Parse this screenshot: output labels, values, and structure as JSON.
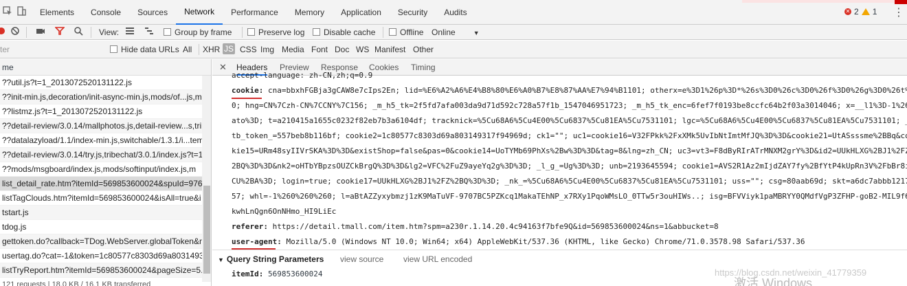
{
  "topbar": {
    "tabs": [
      "Elements",
      "Console",
      "Sources",
      "Network",
      "Performance",
      "Memory",
      "Application",
      "Security",
      "Audits"
    ],
    "active_tab": "Network",
    "error_count": "2",
    "warning_count": "1",
    "error_color": "#d93025",
    "warning_color": "#f2a600",
    "accent": "#1a73e8"
  },
  "toolbar": {
    "view_label": "View:",
    "group_by_frame": "Group by frame",
    "preserve_log": "Preserve log",
    "disable_cache": "Disable cache",
    "offline": "Offline",
    "throttle": "Online"
  },
  "filterbar": {
    "filter_placeholder": "ter",
    "hide_data_urls": "Hide data URLs",
    "types": [
      "All",
      "XHR",
      "JS",
      "CSS",
      "Img",
      "Media",
      "Font",
      "Doc",
      "WS",
      "Manifest",
      "Other"
    ],
    "selected_type": "JS"
  },
  "requests": {
    "name_header": "me",
    "rows": [
      "??util.js?t=1_2013072520131122.js",
      "??init-min.js,decoration/init-async-min.js,mods/of...js,m",
      "??listmz.js?t=1_2013072520131122.js",
      "??detail-review/3.0.14/mallphotos.js,detail-review...s,trib",
      "??datalazyload/1.1/index-min.js,switchable/1.3.1/i...tem",
      "??detail-review/3.0.14/try.js,tribechat/3.0.1/index.js?t=1",
      "??mods/msgboard/index.js,mods/softinput/index.js,m",
      "list_detail_rate.htm?itemId=569853600024&spuId=976",
      "listTagClouds.htm?itemId=569853600024&isAll=true&i",
      "tstart.js",
      "tdog.js",
      "gettoken.do?callback=TDog.WebServer.globalToken&n",
      "usertag.do?cat=-1&token=1c80577c8303d69a8031493",
      "listTryReport.htm?itemId=569853600024&pageSize=5..."
    ],
    "selected_index": 7,
    "status": "121 requests | 18.0 KB / 16.1 KB transferred"
  },
  "detail": {
    "tabs": [
      "Headers",
      "Preview",
      "Response",
      "Cookies",
      "Timing"
    ],
    "active_tab": "Headers",
    "accept_language": "accept-language: zh-CN,zh;q=0.9",
    "cookie_name": "cookie:",
    "cookie_lines": [
      "cna=bbxhFGBja3gCAW8e7cIps2En; lid=%E6%A2%A6%E4%B8%80%E6%A0%B7%E8%87%AA%E7%94%B1101; otherx=e%3D1%26p%3D*%26s%3D0%26c%3D0%26f%3D0%26g%3D0%26t%3",
      "0; hng=CN%7Czh-CN%7CCNY%7C156; _m_h5_tk=2f5fd7afa003da9d71d592c728a57f1b_1547046951723; _m_h5_tk_enc=6fef7f0193be8ccfc64b2f03a3014046; x=__l1%3D-1%26",
      "ato%3D; t=a210415a1655c0232f82eb7b3a6104df; tracknick=%5Cu68A6%5Cu4E00%5Cu6837%5Cu81EA%5Cu7531101; lgc=%5Cu68A6%5Cu4E00%5Cu6837%5Cu81EA%5Cu7531101; _",
      "tb_token_=557beb8b116bf; cookie2=1c80577c8303d69a803149317f94969d; ck1=\"\"; uc1=cookie16=V32FPkk%2FxXMk5UvIbNtImtMfJQ%3D%3D&cookie21=UtASsssme%2BBq&co",
      "kie15=URm48syIIVrSKA%3D%3D&existShop=false&pas=0&cookie14=UoTYMb69PhXs%2Bw%3D%3D&tag=8&lng=zh_CN; uc3=vt3=F8dByRIrATrMNXM2grY%3D&id2=UUkHLXG%2BJ1%2FZ",
      "2BQ%3D%3D&nk2=oHTbYBpzsOUZCkBrgQ%3D%3D&lg2=VFC%2FuZ9ayeYq2g%3D%3D; _l_g_=Ug%3D%3D; unb=2193645594; cookie1=AVS2R1Az2mIjdZAY7fy%2BfYtP4kUpRn3V%2FbBr8i",
      "CU%2BA%3D; login=true; cookie17=UUkHLXG%2BJ1%2FZ%2BQ%3D%3D; _nk_=%5Cu68A6%5Cu4E00%5Cu6837%5Cu81EA%5Cu7531101; uss=\"\"; csg=80aab69d; skt=a6dc7abbb1217",
      "57; whl=-1%260%260%260; l=aBtAZZyxybmzj1zK9MaTuVF-9707BC5PZKcq1MakaTEhNP_x7RXy1PqoWMsLO_0TTw5r3ouHIWs..; isg=BFVViyk1paMBRYY0QMdfVgP3ZFHP-goB2-MIL9f6",
      "kwhLnQgn6OnNHmo_HI9LiEc"
    ],
    "referer_name": "referer:",
    "referer_value": "https://detail.tmall.com/item.htm?spm=a230r.1.14.20.4c94163f7bfe9Q&id=569853600024&ns=1&abbucket=8",
    "ua_name": "user-agent:",
    "ua_value": "Mozilla/5.0 (Windows NT 10.0; Win64; x64) AppleWebKit/537.36 (KHTML, like Gecko) Chrome/71.0.3578.98 Safari/537.36",
    "qs_title": "Query String Parameters",
    "qs_view_source": "view source",
    "qs_view_url_encoded": "view URL encoded",
    "item_id_name": "itemId:",
    "item_id_value": "569853600024",
    "highlight_color": "#d32f2f"
  },
  "watermark": {
    "activate": "激活 Windows",
    "url": "https://blog.csdn.net/weixin_41779359"
  }
}
